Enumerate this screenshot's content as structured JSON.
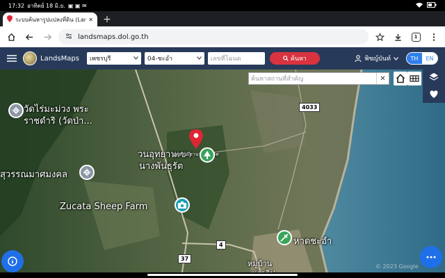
{
  "statusbar": {
    "time": "17:32",
    "date": "อาทิตย์ 18 มิ.ย.",
    "icons": "▣ ▣ ✉"
  },
  "tab": {
    "title": "ระบบค้นหารูปแปลงที่ดิน (Land",
    "close": "✕",
    "new": "+"
  },
  "browser": {
    "url": "landsmaps.dol.go.th",
    "tab_count": "1"
  },
  "app": {
    "brand": "LandsMaps",
    "province": "เพชรบุรี",
    "district": "04-ชะอำ",
    "deed_placeholder": "เลขที่โฉนด",
    "search_label": "ค้นหา",
    "user": "พิชญ์บันท์",
    "lang_th": "TH",
    "lang_en": "EN"
  },
  "map": {
    "place_search_placeholder": "ค้นหาสถานที่สำคัญ",
    "labels": {
      "temple": "วัดไร่มะม่วง พระ",
      "temple2": "ราชดำริ (วัดป่า...",
      "forest": "วนอุทยานเขา",
      "forest2": "นางพันธุรัต",
      "mangkhon": "สุวรรณมาศมงคล",
      "sheep": "Zucata Sheep Farm",
      "beach": "หาดชะอำ",
      "village": "หมู่บ้าน",
      "village2": "นราธิป",
      "road4033": "4033",
      "road4": "4",
      "road37": "37",
      "small": "อุทยานเขานางพันธุรัต",
      "copyright": "© 2023 Google"
    }
  },
  "colors": {
    "appbar": "#283a5a",
    "accent": "#d9333f",
    "fab": "#1f6fe8",
    "marker": "#e02535"
  }
}
